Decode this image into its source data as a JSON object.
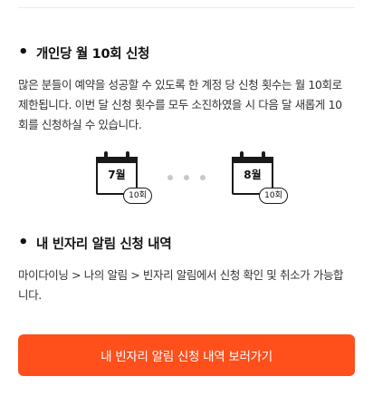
{
  "section1": {
    "bullet": "•",
    "title": "개인당 월 10회 신청",
    "description": "많은 분들이 예약을 성공할 수 있도록 한 계정 당 신청 횟수는 월 10회로 제한됩니다. 이번 달 신청 횟수를 모두 소진하였을 시 다음 달 새롭게 10회를 신청하실 수 있습니다."
  },
  "illustration": {
    "left_calendar": {
      "month": "7월",
      "count": "10회"
    },
    "right_calendar": {
      "month": "8월",
      "count": "10회"
    },
    "dot_color": "#c8c8c8"
  },
  "section2": {
    "bullet": "•",
    "title": "내 빈자리 알림 신청 내역",
    "description": "마이다이닝 > 나의 알림 > 빈자리 알림에서 신청 확인 및 취소가 가능합니다."
  },
  "cta": {
    "label": "내 빈자리 알림 신청 내역 보러가기",
    "color": "#ff4f1b"
  }
}
